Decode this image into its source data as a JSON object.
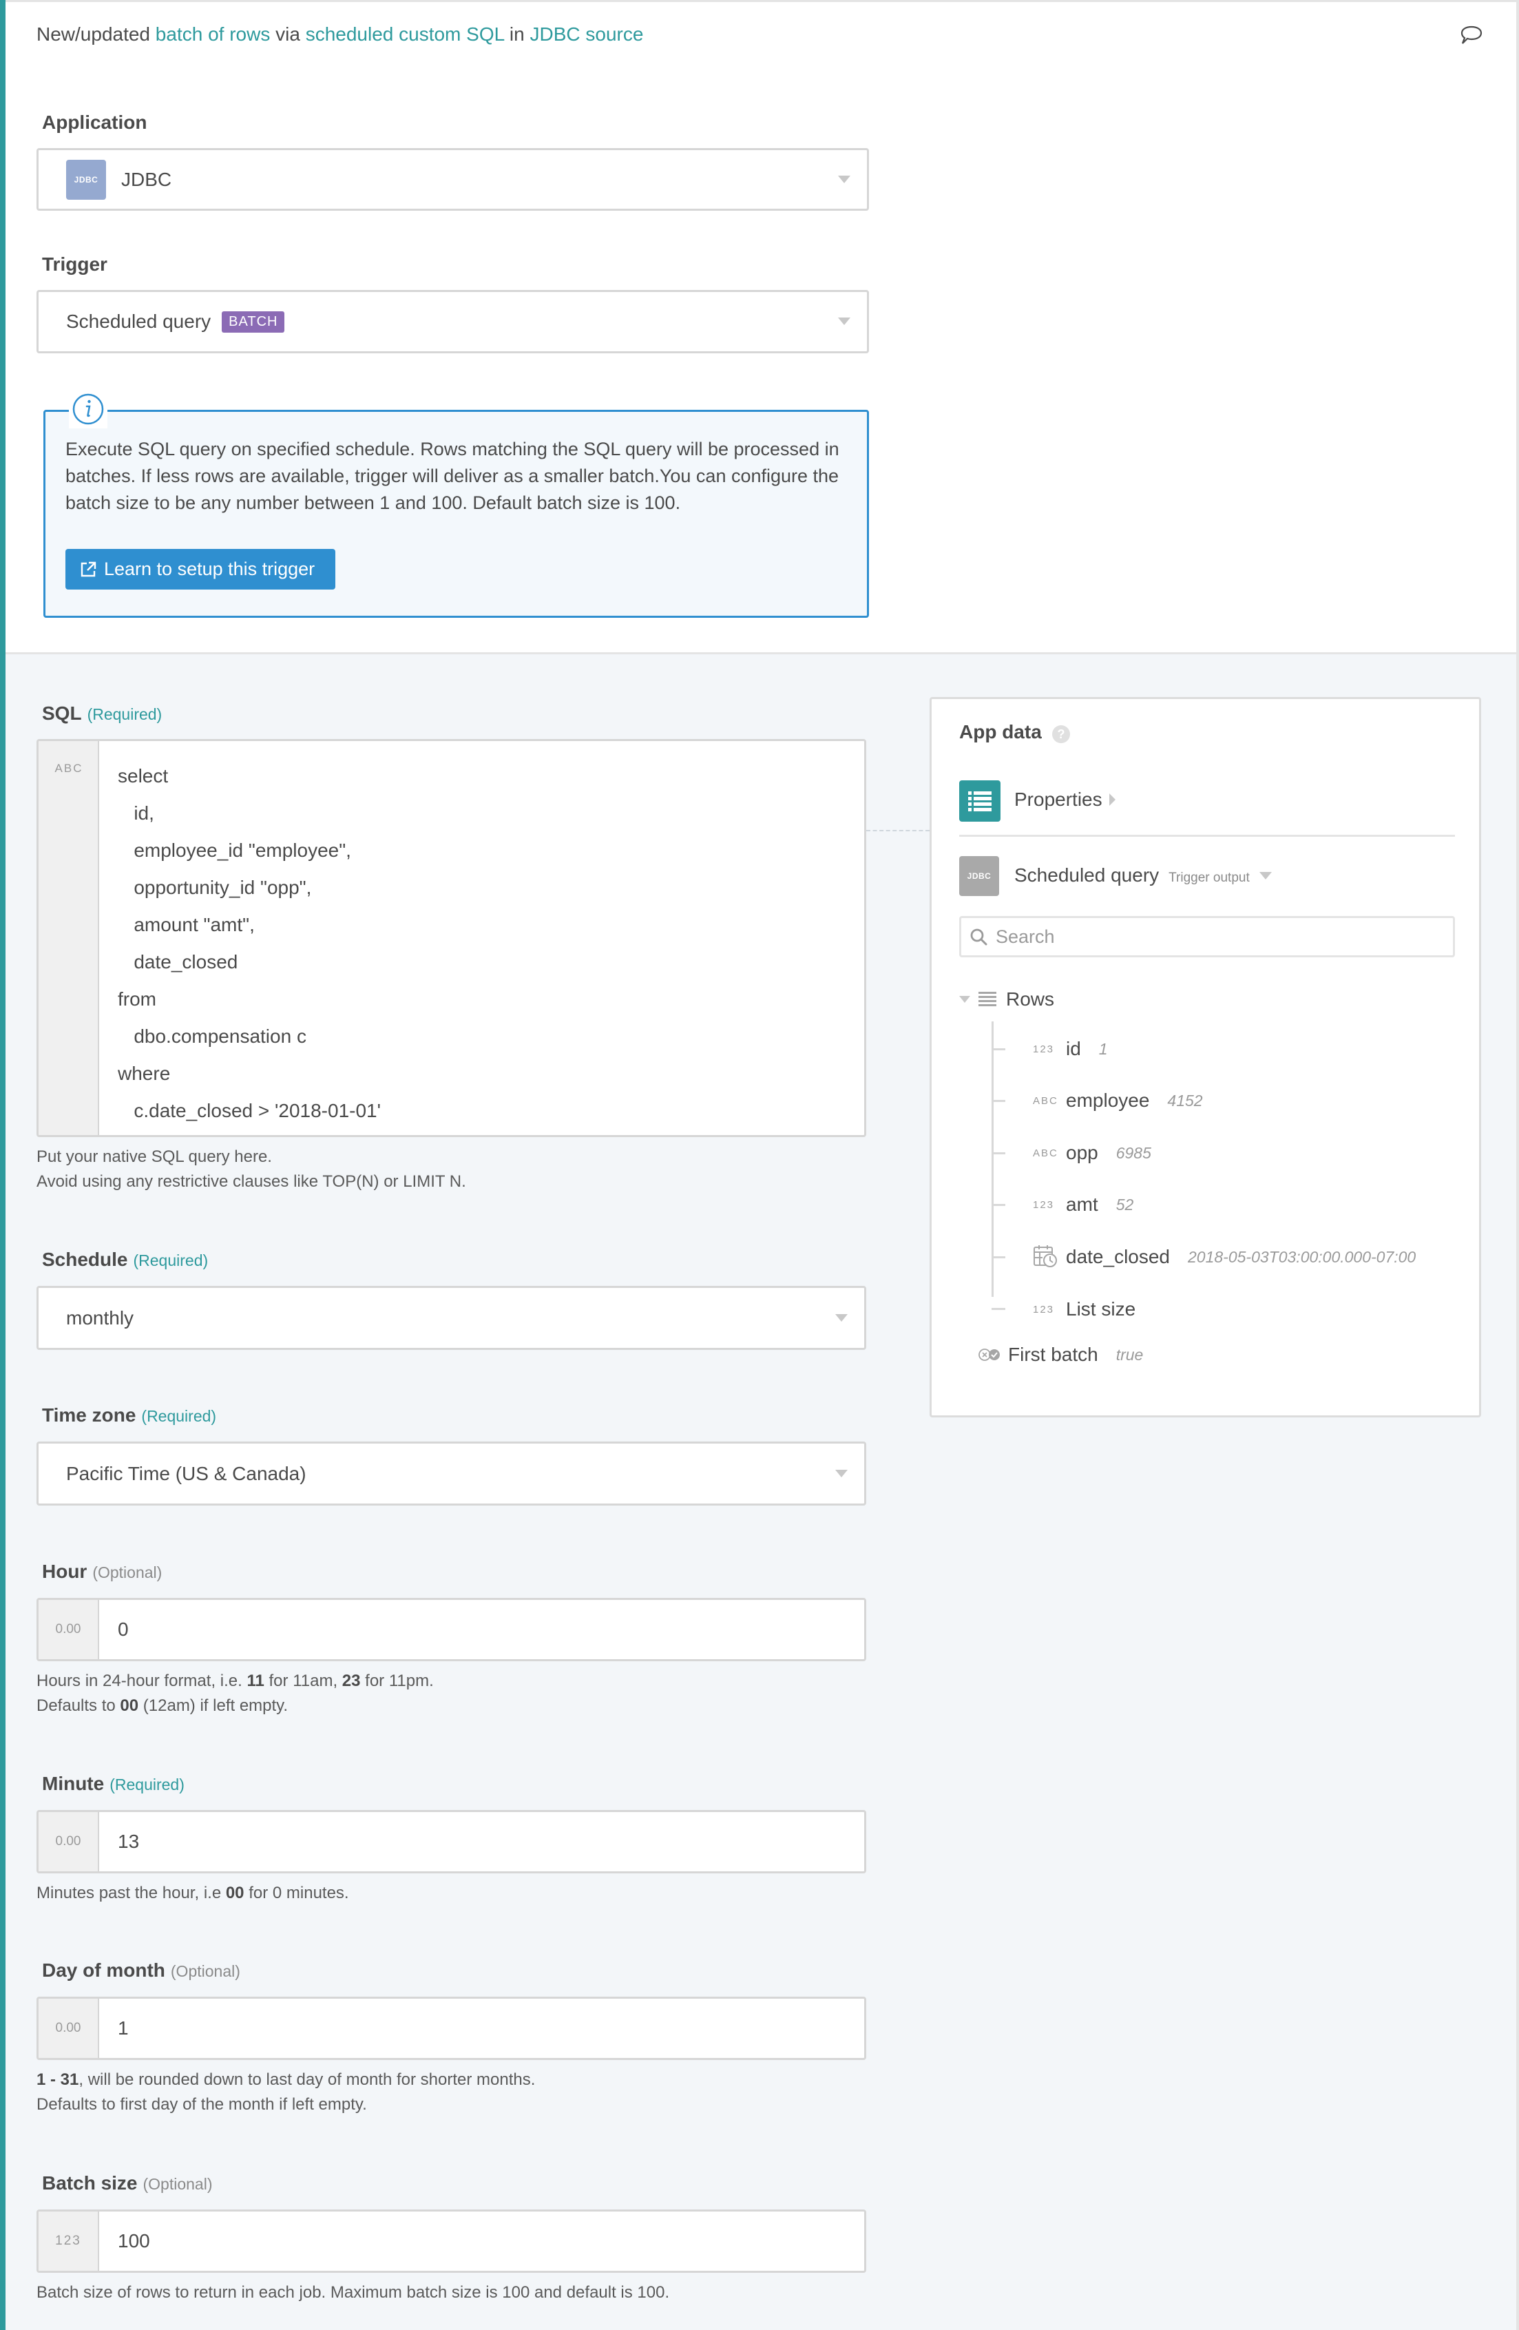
{
  "header": {
    "title_parts": [
      {
        "text": "New/updated ",
        "link": false
      },
      {
        "text": "batch of rows",
        "link": true
      },
      {
        "text": " via ",
        "link": false
      },
      {
        "text": "scheduled custom SQL",
        "link": true
      },
      {
        "text": " in ",
        "link": false
      },
      {
        "text": "JDBC source",
        "link": true
      }
    ],
    "comment_icon": "comment-icon"
  },
  "colors": {
    "accent": "#2e9a9d",
    "info_blue": "#2f8fd0",
    "batch_badge": "#8b6bb5",
    "jdbc_logo": "#95a9d0",
    "jdbc_logo_grey": "#a9a9a9",
    "background": "#f3f6f9"
  },
  "application": {
    "label": "Application",
    "logo_text": "JDBC",
    "value": "JDBC"
  },
  "trigger": {
    "label": "Trigger",
    "value": "Scheduled query",
    "badge": "BATCH"
  },
  "info": {
    "icon": "info-icon",
    "text": "Execute SQL query on specified schedule. Rows matching the SQL query will be processed in batches. If less rows are available, trigger will deliver as a smaller batch.You can configure the batch size to be any number between 1 and 100. Default batch size is 100.",
    "button_label": "Learn to setup this trigger",
    "button_icon": "external-link-icon"
  },
  "sql": {
    "label": "SQL",
    "qualifier": "(Required)",
    "type_badge": "ABC",
    "lines": [
      "select",
      "   id,",
      "   employee_id \"employee\",",
      "   opportunity_id \"opp\",",
      "   amount \"amt\",",
      "   date_closed",
      "from",
      "   dbo.compensation c",
      "where",
      "   c.date_closed > '2018-01-01'"
    ],
    "hint_lines": [
      "Put your native SQL query here.",
      "Avoid using any restrictive clauses like TOP(N) or LIMIT N."
    ]
  },
  "schedule": {
    "label": "Schedule",
    "qualifier": "(Required)",
    "value": "monthly"
  },
  "timezone": {
    "label": "Time zone",
    "qualifier": "(Required)",
    "value": "Pacific Time (US & Canada)"
  },
  "hour": {
    "label": "Hour",
    "qualifier": "(Optional)",
    "type_badge": "0.00",
    "value": "0",
    "hint1_a": "Hours in 24-hour format, i.e. ",
    "hint1_b1": "11",
    "hint1_c": " for 11am, ",
    "hint1_b2": "23",
    "hint1_d": " for 11pm.",
    "hint2_a": "Defaults to ",
    "hint2_b": "00",
    "hint2_c": " (12am) if left empty."
  },
  "minute": {
    "label": "Minute",
    "qualifier": "(Required)",
    "type_badge": "0.00",
    "value": "13",
    "hint_a": "Minutes past the hour, i.e ",
    "hint_b": "00",
    "hint_c": " for 0 minutes."
  },
  "day_of_month": {
    "label": "Day of month",
    "qualifier": "(Optional)",
    "type_badge": "0.00",
    "value": "1",
    "hint1_b": "1 - 31",
    "hint1_c": ", will be rounded down to last day of month for shorter months.",
    "hint2": "Defaults to first day of the month if left empty."
  },
  "batch_size": {
    "label": "Batch size",
    "qualifier": "(Optional)",
    "type_badge": "123",
    "value": "100",
    "hint": "Batch size of rows to return in each job. Maximum batch size is 100 and default is 100."
  },
  "app_data": {
    "title": "App data",
    "help_icon": "?",
    "properties_label": "Properties",
    "source_logo_text": "JDBC",
    "source_label": "Scheduled query",
    "source_sub": "Trigger output",
    "search_placeholder": "Search",
    "rows_label": "Rows",
    "fields": [
      {
        "type": "123",
        "name": "id",
        "sample": "1"
      },
      {
        "type": "ABC",
        "name": "employee",
        "sample": "4152"
      },
      {
        "type": "ABC",
        "name": "opp",
        "sample": "6985"
      },
      {
        "type": "123",
        "name": "amt",
        "sample": "52"
      },
      {
        "type": "date",
        "name": "date_closed",
        "sample": "2018-05-03T03:00:00.000-07:00"
      },
      {
        "type": "123",
        "name": "List size",
        "sample": ""
      }
    ],
    "first_batch": {
      "name": "First batch",
      "sample": "true"
    }
  }
}
